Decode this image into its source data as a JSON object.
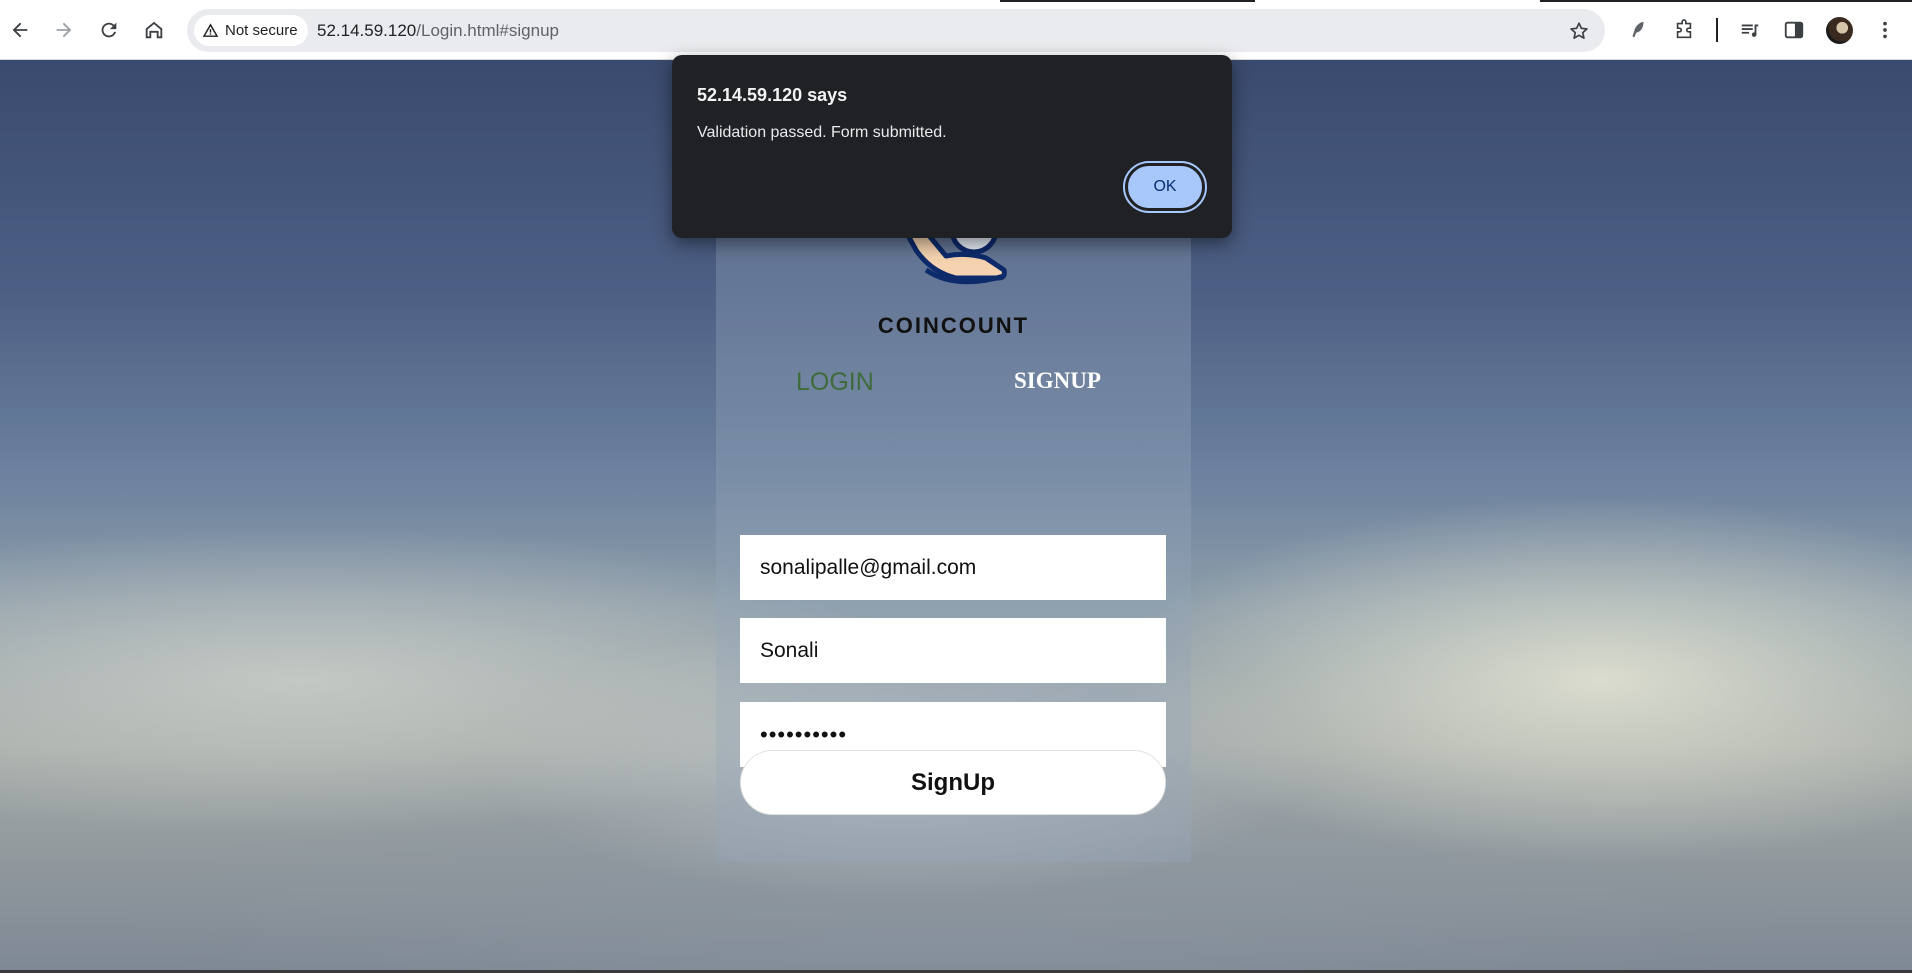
{
  "browser": {
    "security_label": "Not secure",
    "url_host": "52.14.59.120",
    "url_path": "/Login.html#signup"
  },
  "page": {
    "brand_name": "COINCOUNT",
    "tabs": {
      "login_label": "LOGIN",
      "signup_label": "SIGNUP"
    },
    "form": {
      "email_value": "sonalipalle@gmail.com",
      "name_value": "Sonali",
      "password_mask": "••••••••••",
      "submit_label": "SignUp"
    }
  },
  "dialog": {
    "title": "52.14.59.120 says",
    "message": "Validation passed. Form submitted.",
    "ok_label": "OK"
  },
  "colors": {
    "accent_ok": "#a8c7fa",
    "login_tab": "#3f6b3a",
    "dialog_bg": "#202124"
  }
}
